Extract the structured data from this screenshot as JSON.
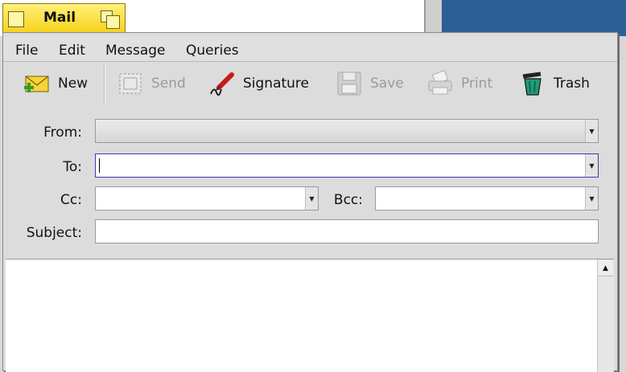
{
  "window": {
    "title": "Mail"
  },
  "menu": {
    "items": [
      "File",
      "Edit",
      "Message",
      "Queries"
    ]
  },
  "toolbar": {
    "new": "New",
    "send": "Send",
    "signature": "Signature",
    "save": "Save",
    "print": "Print",
    "trash": "Trash"
  },
  "form": {
    "from_label": "From:",
    "from_value": "",
    "to_label": "To:",
    "to_value": "",
    "cc_label": "Cc:",
    "cc_value": "",
    "bcc_label": "Bcc:",
    "bcc_value": "",
    "subject_label": "Subject:",
    "subject_value": ""
  },
  "body": {
    "text": ""
  },
  "colors": {
    "title_tab": "#f7d21a",
    "desktop": "#2c5f96",
    "focus_border": "#3a3ab0"
  }
}
